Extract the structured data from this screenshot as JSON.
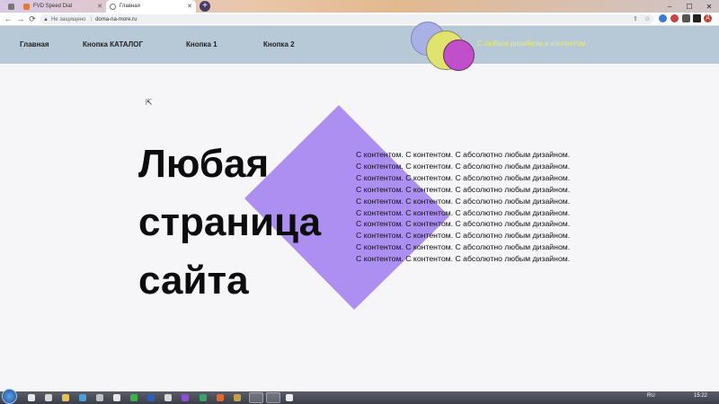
{
  "browser": {
    "tabs": [
      {
        "label": "FVD Speed Dial"
      },
      {
        "label": "Главная"
      }
    ],
    "new_tab_symbol": "+",
    "address": {
      "security_label": "Не защищено",
      "url": "doma-na-more.ru"
    },
    "nav": {
      "back": "←",
      "forward": "→",
      "reload": "⟳"
    },
    "window": {
      "minimize": "–",
      "maximize": "☐",
      "close": "✕"
    },
    "profile_initial": "Д"
  },
  "site": {
    "nav": {
      "home": "Главная",
      "catalog": "Кнопка КАТАЛОГ",
      "button1": "Кнопка 1",
      "button2": "Кнопка 2"
    },
    "tagline": "С любым дизайном и контентом",
    "hero": {
      "line1": "Любая",
      "line2": "страница",
      "line3": "сайта"
    },
    "content_lines": [
      "С контентом. С контентом. С абсолютно любым дизайном.",
      "С контентом. С контентом. С абсолютно любым дизайном.",
      "С контентом. С контентом. С абсолютно любым дизайном.",
      "С контентом. С контентом. С абсолютно любым дизайном.",
      "С контентом. С контентом. С абсолютно любым дизайном.",
      "С контентом. С контентом. С абсолютно любым дизайном.",
      "С контентом. С контентом. С абсолютно любым дизайном.",
      "С контентом. С контентом. С абсолютно любым дизайном.",
      "С контентом. С контентом. С абсолютно любым дизайном.",
      "С контентом. С контентом. С абсолютно любым дизайном."
    ]
  },
  "taskbar": {
    "lang": "RU",
    "time": "15:22"
  },
  "colors": {
    "header_bg": "#b7c8d7",
    "tagline": "#e9ef6b",
    "diamond": "#ad8ff2",
    "bubble_blue": "#a8b0e6",
    "bubble_yellow": "#e0e36d",
    "bubble_magenta": "#c14fc9",
    "page_bg": "#f6f5f8"
  }
}
